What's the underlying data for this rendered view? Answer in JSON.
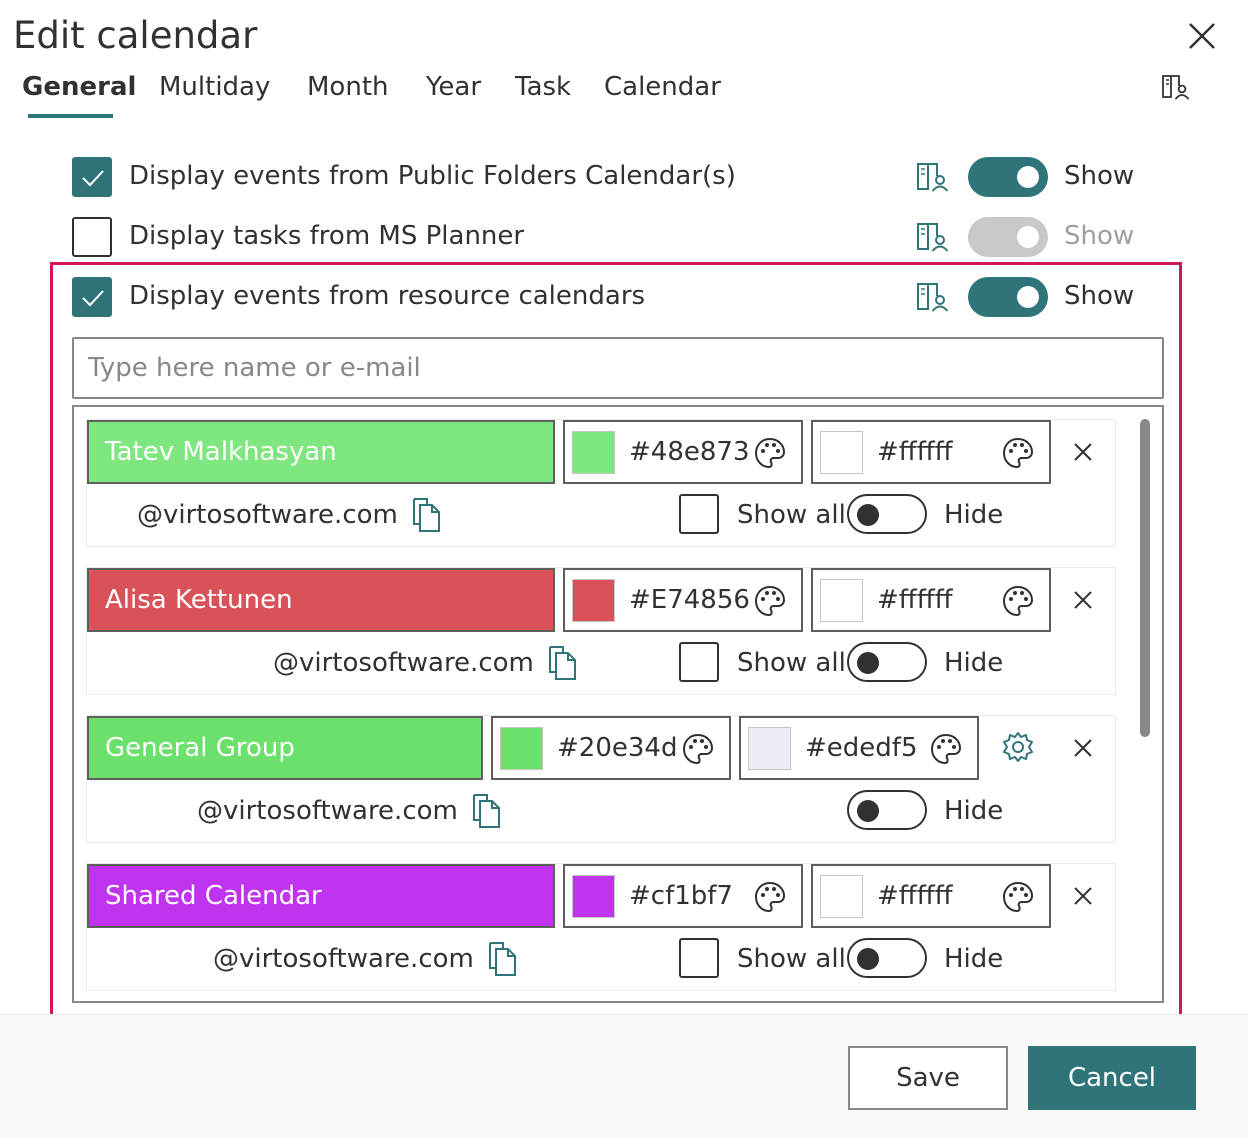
{
  "dialog": {
    "title": "Edit calendar"
  },
  "tabs": [
    {
      "label": "General",
      "active": true
    },
    {
      "label": "Multiday"
    },
    {
      "label": "Month"
    },
    {
      "label": "Year"
    },
    {
      "label": "Task"
    },
    {
      "label": "Calendar"
    }
  ],
  "options": [
    {
      "label": "Display events from Public Folders Calendar(s)",
      "checked": true,
      "toggle_label": "Show",
      "toggle_on": true
    },
    {
      "label": "Display tasks from MS Planner",
      "checked": false,
      "toggle_label": "Show",
      "toggle_on": false,
      "disabled": true
    },
    {
      "label": "Display events from resource calendars",
      "checked": true,
      "toggle_label": "Show",
      "toggle_on": true
    }
  ],
  "search": {
    "placeholder": "Type here name or e-mail",
    "value": ""
  },
  "calendars": [
    {
      "name": "Tatev Malkhasyan",
      "color": "#48e873",
      "text_color": "#ffffff",
      "email": "@virtosoftware.com",
      "show_all_label": "Show all",
      "hide_label": "Hide"
    },
    {
      "name": "Alisa Kettunen",
      "color": "#E74856",
      "text_color": "#ffffff",
      "email": "@virtosoftware.com",
      "show_all_label": "Show all",
      "hide_label": "Hide"
    },
    {
      "name": "General Group",
      "color": "#20e34d",
      "text_color": "#ededf5",
      "email": "@virtosoftware.com",
      "hide_label": "Hide"
    },
    {
      "name": "Shared Calendar",
      "color": "#cf1bf7",
      "text_color": "#ffffff",
      "email": "@virtosoftware.com",
      "show_all_label": "Show all",
      "hide_label": "Hide"
    }
  ],
  "buttons": {
    "save": "Save",
    "cancel": "Cancel"
  },
  "colors": {
    "accent": "#2f7479",
    "highlight_border": "#d2145a",
    "name_bg_1": "#7ee77f",
    "name_bg_2": "#d9525a",
    "name_bg_3": "#6be06a",
    "name_bg_4": "#c034ef"
  }
}
